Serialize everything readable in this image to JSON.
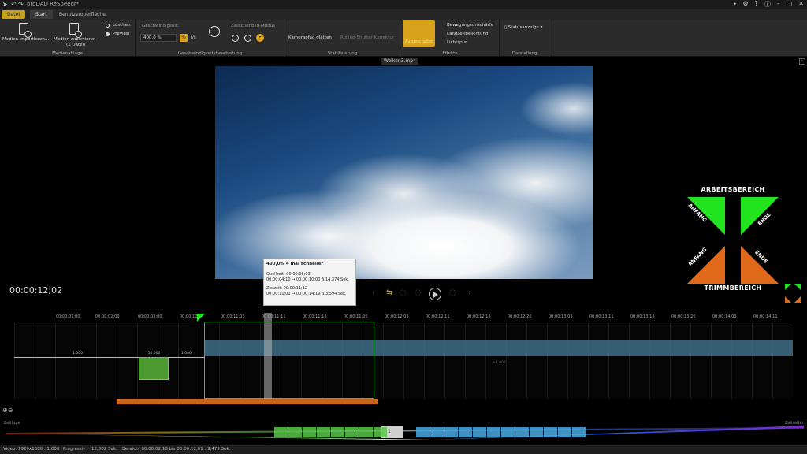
{
  "window": {
    "title": "proDAD ReSpeedr*"
  },
  "tabs": {
    "datei": "Datei",
    "start": "Start",
    "ui": "Benutzeroberfläche"
  },
  "ribbon": {
    "import_label": "Medien importieren...",
    "export_label": "Medien exportieren",
    "export_sub": "(1 Datei)",
    "loeschen": "Löschen",
    "preview": "Preview",
    "medienablage": "Medienablage",
    "geschwindigkeit_label": "Geschwindigkeit:",
    "speed_value": "400,0 %",
    "fps_label": "f/s",
    "zwischenbild_label": "Zwischenbild-Modus",
    "geschwindigkeitsbearbeitung": "Geschwindigkeitsbearbeitung",
    "kamerapfad": "Kamerapfad glätten",
    "rolling_shutter": "Rolling-Shutter Korrektur",
    "stabilisierung": "Stabilisierung",
    "ausgeschaltet": "Ausgeschaltet",
    "bewegungsunschaerfe": "Bewegungsunschärfe",
    "langzeitbelichtung": "Langzeitbelichtung",
    "lichtspur": "Lichtspur",
    "effekte": "Effekte",
    "statusanzeige": "Statusanzeige",
    "darstellung": "Darstellung"
  },
  "video": {
    "filename": "Wolken3.mp4"
  },
  "tooltip": {
    "header": "400,0%  4 mal schneller",
    "quellzeit_label": "Quellzeit: 00:00:06;03",
    "quellzeit_range": "00:00:04;10 → 00:00:10;00   Δ 14,374 Sek.",
    "zielzeit_label": "Zielzeit: 00:00:11;12",
    "zielzeit_range": "00:00:11;01 → 00:00:14;19   Δ 3,594 Sek."
  },
  "legend": {
    "arbeitsbereich": "ARBEITSBEREICH",
    "trimmbereich": "TRIMMBEREICH",
    "anfang_top": "ANFANG",
    "ende_top": "ENDE",
    "anfang_bottom": "ANFANG",
    "ende_bottom": "ENDE",
    "green": "#22e51f",
    "orange": "#e06a1a"
  },
  "player": {
    "timecode": "00:00:12;02"
  },
  "timeline": {
    "ticks": [
      "00;00;01;00",
      "00;00;02;00",
      "00;00;03;00",
      "00;00;10;",
      "00;00;11;03",
      "00;00;11;11",
      "00;00;11;18",
      "00;00;11;26",
      "00;00;12;03",
      "00;00;12;11",
      "00;00;12;18",
      "00;00;12;26",
      "00;00;13;03",
      "00;00;13;11",
      "00;00;13;18",
      "00;00;13;26",
      "00;00;14;03",
      "00;00;14;11"
    ],
    "seg_1000_a": "1.000",
    "seg_neg": "-10.000",
    "seg_1000_b": "1.000",
    "seg_right": "+4.000"
  },
  "speedbar": {
    "zeitlupe": "Zeitlupe",
    "zeitraffer": "Zeitraffer",
    "center_value": "1"
  },
  "status": {
    "video": "Video: 1920x1080 : 1,000",
    "progressiv": "Progressiv",
    "duration": "12,082 Sek.",
    "bereich": "Bereich: 00:00:02;18 bis 00:00:12;01 : 9,479 Sek."
  }
}
